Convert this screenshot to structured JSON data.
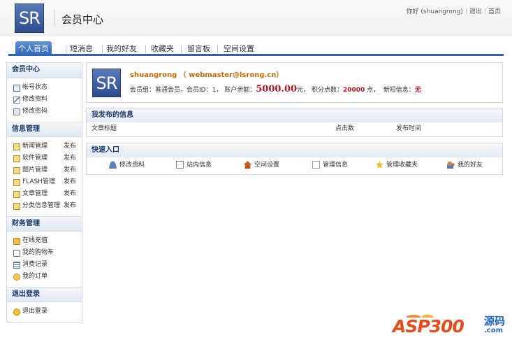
{
  "header": {
    "logo_text": "SR",
    "title": "会员中心",
    "greeting": "你好 (shuangrong)",
    "logout": "退出",
    "home": "首页"
  },
  "tabs": [
    {
      "label": "个人首页",
      "active": true
    },
    {
      "label": "短消息"
    },
    {
      "label": "我的好友"
    },
    {
      "label": "收藏夹"
    },
    {
      "label": "留言板"
    },
    {
      "label": "空间设置"
    }
  ],
  "sidebar": {
    "member_center": {
      "title": "会员中心",
      "items": [
        {
          "label": "帐号状态",
          "icon": "card-icon"
        },
        {
          "label": "修改资料",
          "icon": "pen-icon"
        },
        {
          "label": "修改密码",
          "icon": "lock-icon"
        }
      ]
    },
    "info_manage": {
      "title": "信息管理",
      "publish": "发布",
      "items": [
        {
          "label": "新闻管理",
          "icon": "doc-icon"
        },
        {
          "label": "软件管理",
          "icon": "doc-icon"
        },
        {
          "label": "图片管理",
          "icon": "doc-icon"
        },
        {
          "label": "FLASH管理",
          "icon": "doc-icon"
        },
        {
          "label": "文章管理",
          "icon": "doc-icon"
        },
        {
          "label": "分类信息管理",
          "icon": "doc-icon"
        }
      ]
    },
    "finance": {
      "title": "财务管理",
      "items": [
        {
          "label": "在线充值",
          "icon": "money-icon"
        },
        {
          "label": "我的购物车",
          "icon": "cart-icon"
        },
        {
          "label": "消费记录",
          "icon": "list-icon"
        },
        {
          "label": "我的订单",
          "icon": "order-icon"
        }
      ]
    },
    "logout": {
      "title": "退出登录",
      "items": [
        {
          "label": "退出登录",
          "icon": "bulb-icon"
        }
      ]
    }
  },
  "profile": {
    "avatar_text": "SR",
    "username_line": "shuangrong （ webmaster@lsrong.cn）",
    "group_label": "会员组：",
    "group_value": "普通会员",
    "id_label": "，会员ID：",
    "id_value": "1",
    "balance_label": "， 账户余额：",
    "balance_value": "5000.00",
    "balance_unit": "元，",
    "points_label": "积分点数：",
    "points_value": "20000",
    "points_unit": "点，",
    "msg_label": "新短信息：",
    "msg_value": "无"
  },
  "my_info": {
    "title": "我发布的信息",
    "col_title": "文章标题",
    "col_clicks": "点击数",
    "col_time": "发布时间"
  },
  "quick": {
    "title": "快速入口",
    "items": [
      {
        "label": "修改资料",
        "icon": "user-icon"
      },
      {
        "label": "站内信息",
        "icon": "mail-icon"
      },
      {
        "label": "空间设置",
        "icon": "home-icon"
      },
      {
        "label": "管理信息",
        "icon": "document-icon"
      },
      {
        "label": "管理收藏夹",
        "icon": "star-icon"
      },
      {
        "label": "我的好友",
        "icon": "friends-icon"
      }
    ]
  },
  "watermark": {
    "brand": "ASP300",
    "cn": "源码",
    "domain": ".com"
  }
}
